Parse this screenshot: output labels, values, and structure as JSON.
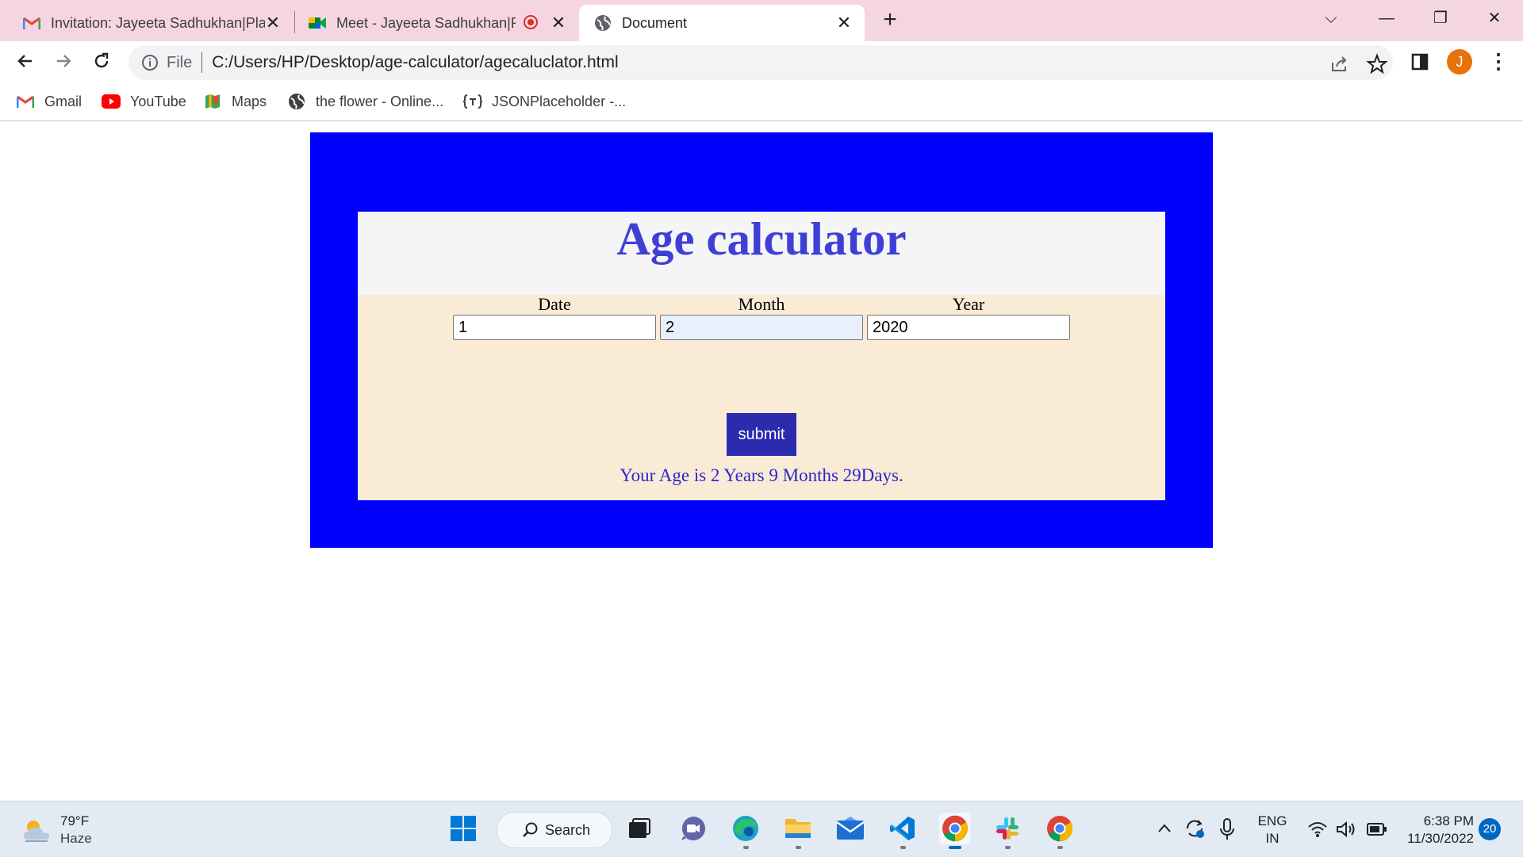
{
  "browser": {
    "tabs": [
      {
        "title": "Invitation: Jayeeta Sadhukhan|Pla",
        "icon": "gmail-icon",
        "close": "✕"
      },
      {
        "title": "Meet - Jayeeta Sadhukhan|Pl",
        "icon": "google-meet-icon",
        "close": "✕"
      },
      {
        "title": "Document",
        "icon": "globe-icon",
        "close": "✕",
        "active": true
      }
    ],
    "new_tab": "+",
    "window_controls": {
      "dropdown": "⌵",
      "minimize": "—",
      "restore": "❐",
      "close": "✕"
    },
    "address": {
      "scheme_label": "File",
      "url": "C:/Users/HP/Desktop/age-calculator/agecaluclator.html"
    },
    "avatar_letter": "J",
    "bookmarks": [
      {
        "label": "Gmail",
        "icon": "gmail-icon"
      },
      {
        "label": "YouTube",
        "icon": "youtube-icon"
      },
      {
        "label": "Maps",
        "icon": "maps-icon"
      },
      {
        "label": "the flower - Online...",
        "icon": "globe-icon"
      },
      {
        "label": "JSONPlaceholder -...",
        "icon": "jsonplaceholder-icon"
      }
    ]
  },
  "page": {
    "heading": "Age calculator",
    "fields": {
      "date": {
        "label": "Date",
        "value": "1"
      },
      "month": {
        "label": "Month",
        "value": "2"
      },
      "year": {
        "label": "Year",
        "value": "2020"
      }
    },
    "submit_label": "submit",
    "result": "Your Age is 2 Years 9 Months 29Days.",
    "colors": {
      "outer_bg": "#0000ff",
      "panel_bg": "#faebd7",
      "heading": "#3f3fd8",
      "button": "#2b2bb0"
    }
  },
  "taskbar": {
    "weather": {
      "temp": "79°F",
      "condition": "Haze"
    },
    "search_label": "Search",
    "apps": [
      "windows-start-icon",
      "task-view-icon",
      "teams-chat-icon",
      "edge-icon",
      "file-explorer-icon",
      "mail-icon",
      "vscode-icon",
      "chrome-icon",
      "slack-icon",
      "chrome-icon"
    ],
    "tray": {
      "lang_top": "ENG",
      "lang_bottom": "IN",
      "time": "6:38 PM",
      "date": "11/30/2022",
      "notifications": "20"
    }
  }
}
